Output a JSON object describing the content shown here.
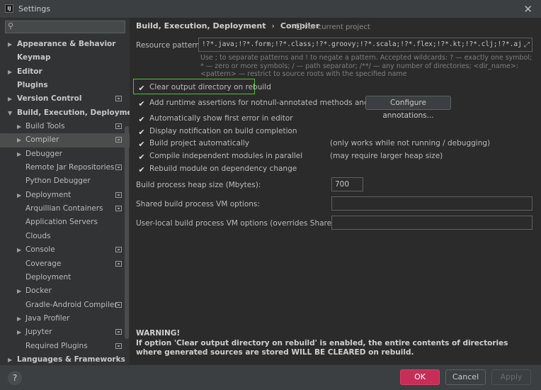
{
  "window": {
    "title": "Settings",
    "app_icon_text": "IJ"
  },
  "sidebar": {
    "search": {
      "placeholder": ""
    },
    "items": [
      {
        "label": "Appearance & Behavior",
        "level": 0,
        "arrow": "▶",
        "bold": true,
        "project": false
      },
      {
        "label": "Keymap",
        "level": 0,
        "arrow": "",
        "bold": true,
        "project": false
      },
      {
        "label": "Editor",
        "level": 0,
        "arrow": "▶",
        "bold": true,
        "project": false
      },
      {
        "label": "Plugins",
        "level": 0,
        "arrow": "",
        "bold": true,
        "project": false
      },
      {
        "label": "Version Control",
        "level": 0,
        "arrow": "▶",
        "bold": true,
        "project": true
      },
      {
        "label": "Build, Execution, Deployment",
        "level": 0,
        "arrow": "▼",
        "bold": true,
        "project": false
      },
      {
        "label": "Build Tools",
        "level": 1,
        "arrow": "▶",
        "bold": false,
        "project": true
      },
      {
        "label": "Compiler",
        "level": 1,
        "arrow": "▶",
        "bold": false,
        "project": true,
        "selected": true
      },
      {
        "label": "Debugger",
        "level": 1,
        "arrow": "▶",
        "bold": false,
        "project": false
      },
      {
        "label": "Remote Jar Repositories",
        "level": 1,
        "arrow": "",
        "bold": false,
        "project": true
      },
      {
        "label": "Python Debugger",
        "level": 1,
        "arrow": "",
        "bold": false,
        "project": false
      },
      {
        "label": "Deployment",
        "level": 1,
        "arrow": "▶",
        "bold": false,
        "project": true
      },
      {
        "label": "Arquillian Containers",
        "level": 1,
        "arrow": "",
        "bold": false,
        "project": true
      },
      {
        "label": "Application Servers",
        "level": 1,
        "arrow": "",
        "bold": false,
        "project": false
      },
      {
        "label": "Clouds",
        "level": 1,
        "arrow": "",
        "bold": false,
        "project": false
      },
      {
        "label": "Console",
        "level": 1,
        "arrow": "▶",
        "bold": false,
        "project": true
      },
      {
        "label": "Coverage",
        "level": 1,
        "arrow": "",
        "bold": false,
        "project": true
      },
      {
        "label": "Deployment",
        "level": 1,
        "arrow": "",
        "bold": false,
        "project": false
      },
      {
        "label": "Docker",
        "level": 1,
        "arrow": "▶",
        "bold": false,
        "project": false
      },
      {
        "label": "Gradle-Android Compiler",
        "level": 1,
        "arrow": "",
        "bold": false,
        "project": true
      },
      {
        "label": "Java Profiler",
        "level": 1,
        "arrow": "▶",
        "bold": false,
        "project": false
      },
      {
        "label": "Jupyter",
        "level": 1,
        "arrow": "▶",
        "bold": false,
        "project": true
      },
      {
        "label": "Required Plugins",
        "level": 1,
        "arrow": "",
        "bold": false,
        "project": true
      },
      {
        "label": "Languages & Frameworks",
        "level": 0,
        "arrow": "▶",
        "bold": true,
        "project": false
      }
    ]
  },
  "breadcrumb": {
    "part1": "Build, Execution, Deployment",
    "separator": "›",
    "part2": "Compiler"
  },
  "scope_note": "For current project",
  "resource_patterns": {
    "label": "Resource patterns:",
    "value": "!?*.java;!?*.form;!?*.class;!?*.groovy;!?*.scala;!?*.flex;!?*.kt;!?*.clj;!?*.aj",
    "hint": "Use ; to separate patterns and ! to negate a pattern. Accepted wildcards: ? — exactly one symbol; * — zero or more symbols; / — path separator; /**/ — any number of directories; <dir_name>:<pattern> — restrict to source roots with the specified name"
  },
  "options": {
    "clear_output": {
      "label": "Clear output directory on rebuild",
      "checked": true
    },
    "add_assertions": {
      "label": "Add runtime assertions for notnull-annotated methods and parameters",
      "checked": true
    },
    "configure_button": "Configure annotations...",
    "show_first_error": {
      "label": "Automatically show first error in editor",
      "checked": true
    },
    "display_notification": {
      "label": "Display notification on build completion",
      "checked": true
    },
    "build_auto": {
      "label": "Build project automatically",
      "checked": true,
      "note": "(only works while not running / debugging)"
    },
    "parallel": {
      "label": "Compile independent modules in parallel",
      "checked": true,
      "note": "(may require larger heap size)"
    },
    "rebuild_dep": {
      "label": "Rebuild module on dependency change",
      "checked": true
    }
  },
  "heap": {
    "label": "Build process heap size (Mbytes):",
    "value": "700"
  },
  "shared_vm": {
    "label": "Shared build process VM options:",
    "value": ""
  },
  "user_vm": {
    "label": "User-local build process VM options (overrides Shared options):",
    "value": ""
  },
  "warning": {
    "title": "WARNING!",
    "text": "If option 'Clear output directory on rebuild' is enabled, the entire contents of directories where generated sources are stored WILL BE CLEARED on rebuild."
  },
  "footer": {
    "help": "?",
    "ok": "OK",
    "cancel": "Cancel",
    "apply": "Apply"
  },
  "colors": {
    "accent": "#c62e58",
    "highlight": "#4fc22b",
    "background": "#2b2b2b"
  }
}
